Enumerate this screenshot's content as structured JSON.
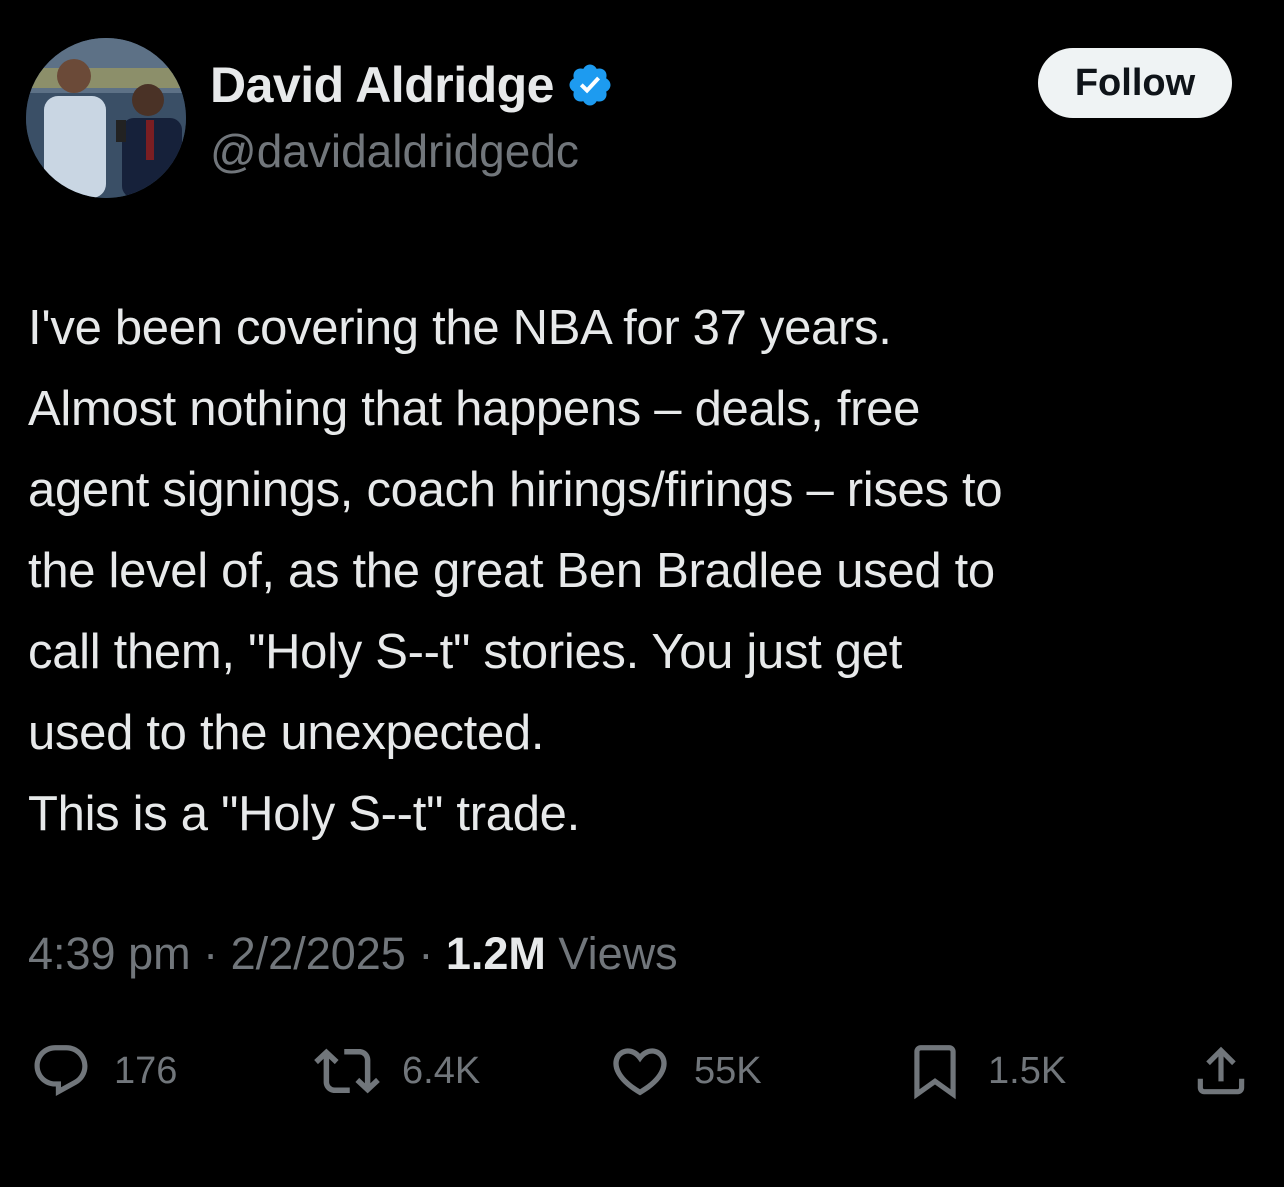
{
  "author": {
    "display_name": "David Aldridge",
    "handle": "@davidaldridgedc",
    "verified": true,
    "verified_color": "#1d9bf0"
  },
  "follow_button": {
    "label": "Follow"
  },
  "tweet": {
    "lines": [
      "I've been covering the NBA for 37 years.",
      "Almost nothing that happens – deals, free",
      "agent signings, coach hirings/firings – rises to",
      "the level of, as the great Ben Bradlee used to",
      "call them, \"Holy S--t\" stories. You just get",
      "used to the unexpected.",
      "This is a \"Holy S--t\" trade."
    ]
  },
  "meta": {
    "time": "4:39 pm",
    "separator": "·",
    "date": "2/2/2025",
    "views_count": "1.2M",
    "views_label": "Views"
  },
  "actions": {
    "replies": "176",
    "retweets": "6.4K",
    "likes": "55K",
    "bookmarks": "1.5K"
  },
  "icons": {
    "verified": "verified-badge-icon",
    "reply": "reply-icon",
    "retweet": "retweet-icon",
    "like": "heart-icon",
    "bookmark": "bookmark-icon",
    "share": "share-icon"
  },
  "colors": {
    "background": "#000000",
    "text_primary": "#e7e9ea",
    "text_secondary": "#71767b",
    "follow_bg": "#eff3f4",
    "accent": "#1d9bf0"
  }
}
